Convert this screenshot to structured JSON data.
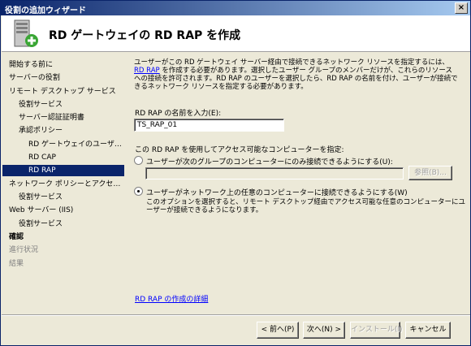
{
  "window": {
    "title": "役割の追加ウィザード",
    "close_label": "×"
  },
  "header": {
    "title": "RD ゲートウェイの RD RAP を作成"
  },
  "nav": {
    "items": [
      {
        "label": "開始する前に"
      },
      {
        "label": "サーバーの役割"
      },
      {
        "label": "リモート デスクトップ サービス"
      },
      {
        "label": "役割サービス"
      },
      {
        "label": "サーバー認証証明書"
      },
      {
        "label": "承認ポリシー"
      },
      {
        "label": "RD ゲートウェイのユーザー グループ"
      },
      {
        "label": "RD CAP"
      },
      {
        "label": "RD RAP"
      },
      {
        "label": "ネットワーク ポリシーとアクセス サービス"
      },
      {
        "label": "役割サービス"
      },
      {
        "label": "Web サーバー (IIS)"
      },
      {
        "label": "役割サービス"
      },
      {
        "label": "確認"
      },
      {
        "label": "進行状況"
      },
      {
        "label": "結果"
      }
    ]
  },
  "content": {
    "description_before_link": "ユーザーがこの RD ゲートウェイ サーバー経由で接続できるネットワーク リソースを指定するには、",
    "description_link": "RD RAP",
    "description_after_link": " を作成する必要があります。選択したユーザー グループのメンバーだけが、これらのリソースへの接続を許可されます。RD RAP のユーザーを選択したら、RD RAP の名前を付け、ユーザーが接続できるネットワーク リソースを指定する必要があります。",
    "name_label": "RD RAP の名前を入力(E):",
    "name_value": "TS_RAP_01",
    "computers_label": "この RD RAP を使用してアクセス可能なコンピューターを指定:",
    "option_group_label": "ユーザーが次のグループのコンピューターにのみ接続できるようにする(U):",
    "group_value": "",
    "browse_label": "参照(B)...",
    "option_any_label": "ユーザーがネットワーク上の任意のコンピューターに接続できるようにする(W)",
    "option_any_note": "このオプションを選択すると、リモート デスクトップ経由でアクセス可能な任意のコンピューターにユーザーが接続できるようになります。",
    "details_link": "RD RAP の作成の詳細"
  },
  "buttons": {
    "back": "< 前へ(P)",
    "next": "次へ(N) >",
    "install": "インストール(I)",
    "cancel": "キャンセル"
  },
  "colors": {
    "selection": "#0a246a",
    "link": "#0000ff",
    "title_bar": "#0a246a"
  }
}
